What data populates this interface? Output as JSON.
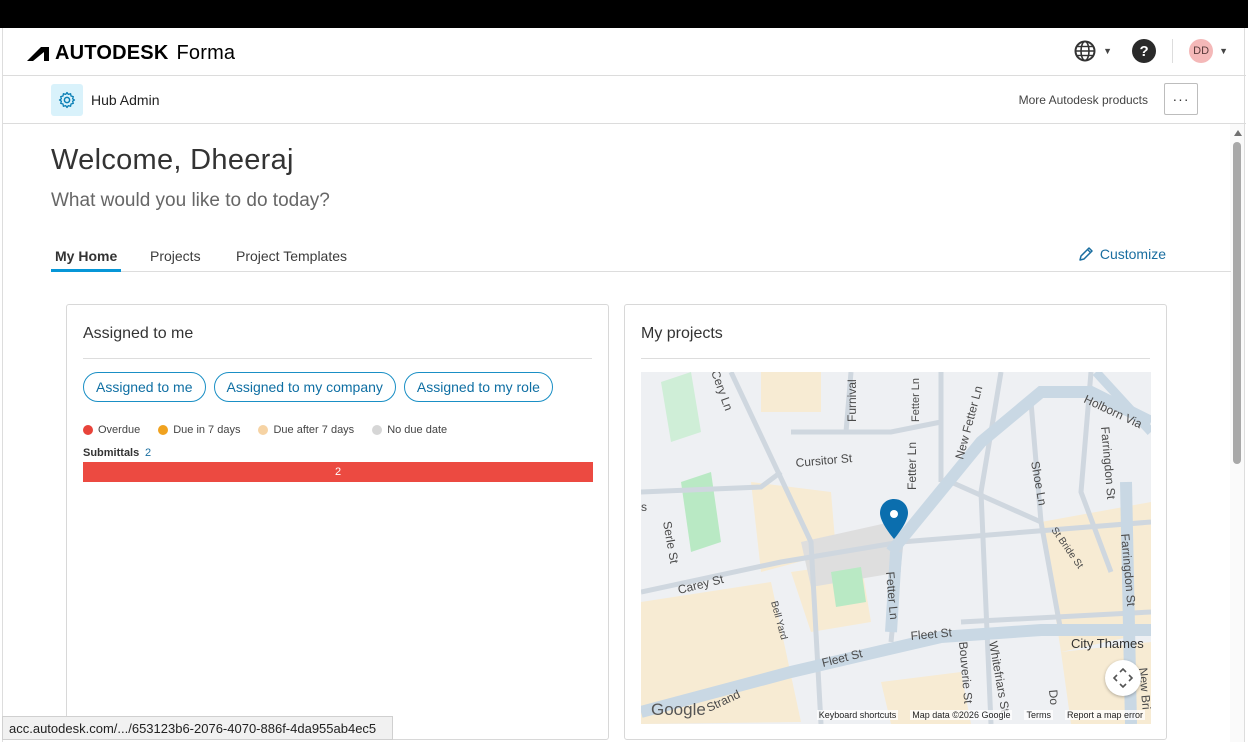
{
  "app": {
    "brand": "AUTODESK",
    "product": "Forma",
    "avatar_initials": "DD",
    "help_label": "?"
  },
  "subheader": {
    "hub_label": "Hub Admin",
    "more_products": "More Autodesk products",
    "more_menu": "···"
  },
  "welcome": {
    "title": "Welcome, Dheeraj",
    "subtitle": "What would you like to do today?"
  },
  "tabs": [
    {
      "label": "My Home",
      "active": true
    },
    {
      "label": "Projects",
      "active": false
    },
    {
      "label": "Project Templates",
      "active": false
    }
  ],
  "customize_label": "Customize",
  "assigned_card": {
    "title": "Assigned to me",
    "filters": [
      "Assigned to me",
      "Assigned to my company",
      "Assigned to my role"
    ],
    "legend": [
      {
        "label": "Overdue",
        "color": "#e8433a"
      },
      {
        "label": "Due in 7 days",
        "color": "#f0a21f"
      },
      {
        "label": "Due after 7 days",
        "color": "#f6d3a4"
      },
      {
        "label": "No due date",
        "color": "#d6d6d6"
      }
    ],
    "submittals_label": "Submittals",
    "submittals_count": "2",
    "bar_value": "2",
    "bar_color": "#ec4a41"
  },
  "projects_card": {
    "title": "My projects",
    "map_labels": {
      "cery_ln": "Cery Ln",
      "furnival": "Furnival",
      "fetter_ln_top": "Fetter Ln",
      "new_fetter_ln": "New Fetter Ln",
      "holborn": "Holborn Via",
      "farringdon_st_top": "Farringdon St",
      "cursitor_st": "Cursitor St",
      "fetter_ln_mid": "Fetter Ln",
      "shoe_ln": "Shoe Ln",
      "serle_st": "Serle St",
      "st_bride_st": "St Bride St",
      "farringdon_st_bottom": "Farringdon St",
      "carey_st": "Carey St",
      "bell_yard": "Bell Yard",
      "fetter_ln_bottom": "Fetter Ln",
      "fleet_st_right": "Fleet St",
      "city_thames": "City Thames",
      "fleet_st_left": "Fleet St",
      "bouverie_st": "Bouverie St",
      "whitefriars_st": "Whitefriars St",
      "do_partial": "Do",
      "new_bri": "New Bri",
      "strand": "Strand",
      "s_partial": "s"
    },
    "google_logo": "Google",
    "footer": [
      "Keyboard shortcuts",
      "Map data ©2026 Google",
      "Terms",
      "Report a map error"
    ]
  },
  "status_url": "acc.autodesk.com/.../653123b6-2076-4070-886f-4da955ab4ec5"
}
